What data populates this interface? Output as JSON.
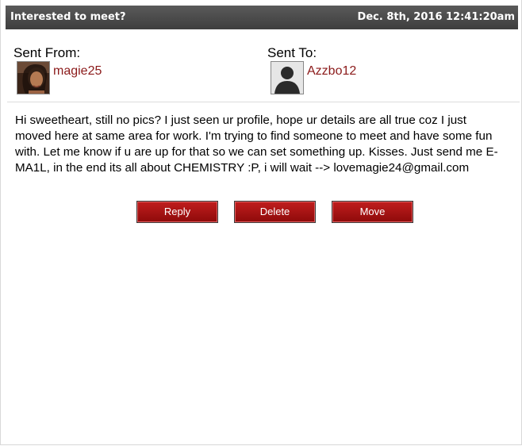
{
  "message": {
    "subject": "Interested to meet?",
    "date": "Dec. 8th, 2016 12:41:20am",
    "sent_from_label": "Sent From:",
    "sent_to_label": "Sent To:",
    "sender": "magie25",
    "recipient": "Azzbo12",
    "body": "Hi sweetheart, still no pics? I just seen ur profile, hope ur details are all true coz I just moved here at same area for work. I'm trying to find someone to meet and have some fun with. Let me know if u are up for that so we can set something up. Kisses. Just send me E-MA1L, in the end its all about CHEMISTRY :P, i will wait --> lovemagie24@gmail.com"
  },
  "actions": {
    "reply": "Reply",
    "delete": "Delete",
    "move": "Move"
  },
  "colors": {
    "header_bg": "#484848",
    "username": "#8b1a1a",
    "button_bg": "#a81414"
  }
}
